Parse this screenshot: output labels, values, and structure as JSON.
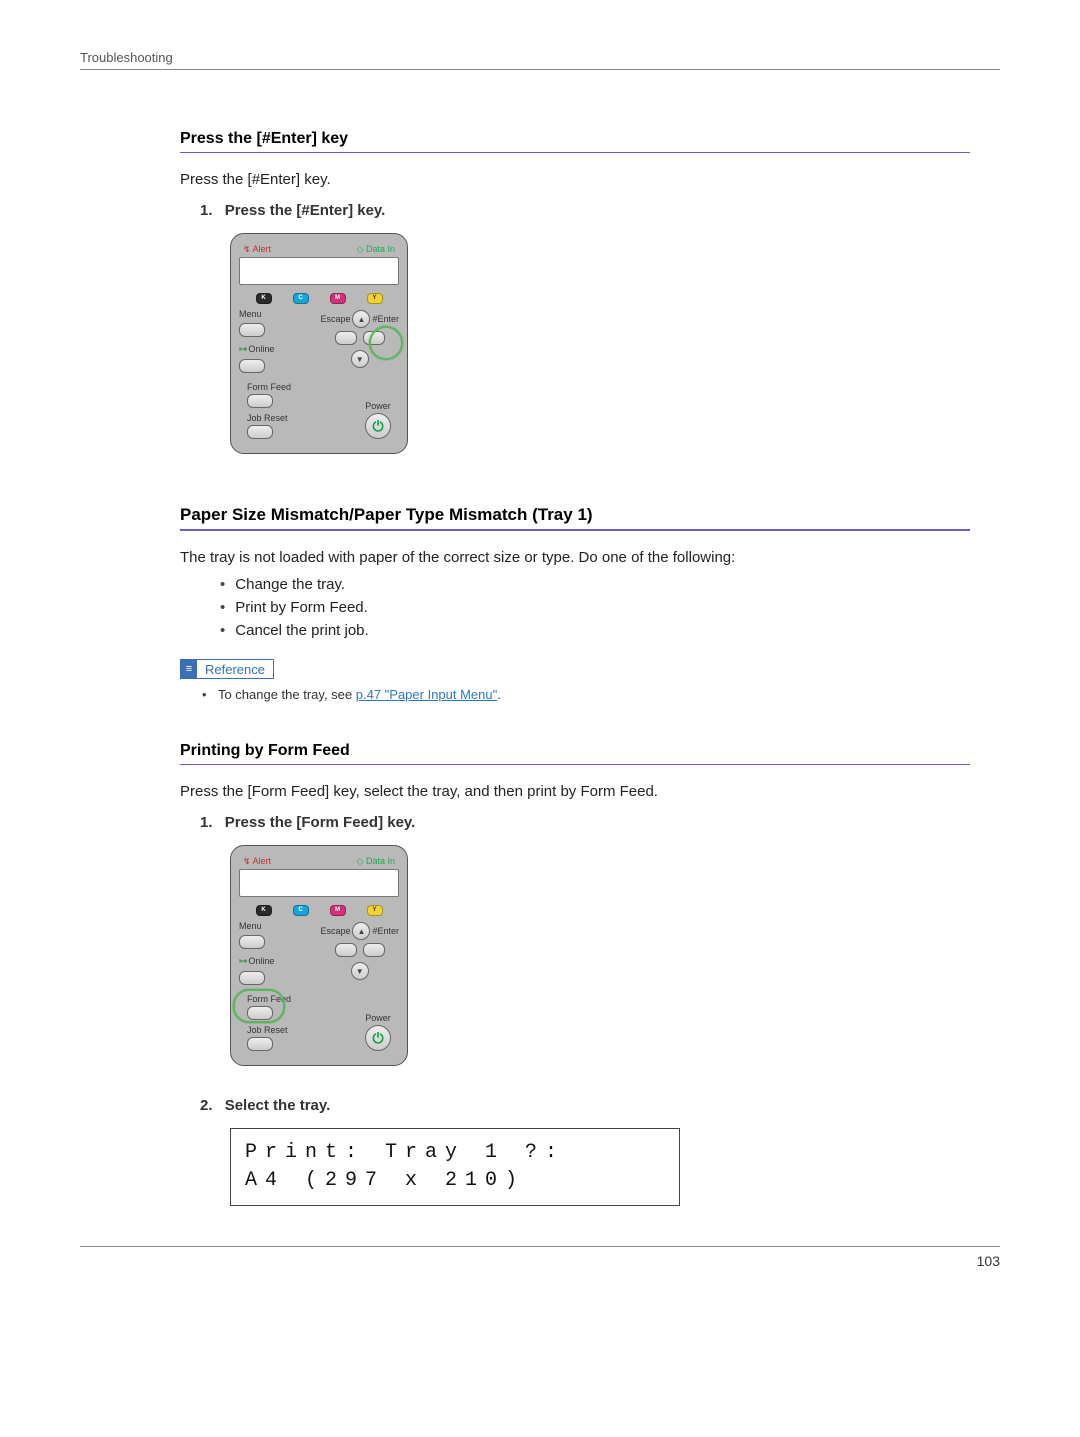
{
  "breadcrumb": "Troubleshooting",
  "page_number": "103",
  "section1": {
    "heading": "Press the [#Enter] key",
    "intro": "Press the [#Enter] key.",
    "step1_num": "1.",
    "step1_text": "Press the [#Enter] key."
  },
  "panel": {
    "alert": "Alert",
    "data_in": "Data In",
    "toner_k": "K",
    "toner_c": "C",
    "toner_m": "M",
    "toner_y": "Y",
    "menu": "Menu",
    "escape": "Escape",
    "enter": "#Enter",
    "online": "Online",
    "form_feed": "Form Feed",
    "job_reset": "Job Reset",
    "power": "Power",
    "up": "▲",
    "down": "▼",
    "power_symbol": "⏻"
  },
  "section2": {
    "heading": "Paper Size Mismatch/Paper Type Mismatch (Tray 1)",
    "intro": "The tray is not loaded with paper of the correct size or type. Do one of the following:",
    "bullets": [
      "Change the tray.",
      "Print by Form Feed.",
      "Cancel the print job."
    ],
    "reference_label": "Reference",
    "reference_text_pre": "To change the tray, see ",
    "reference_link": "p.47 \"Paper Input Menu\"",
    "reference_text_post": "."
  },
  "section3": {
    "heading": "Printing by Form Feed",
    "intro": "Press the [Form Feed] key, select the tray, and then print by Form Feed.",
    "step1_num": "1.",
    "step1_text": "Press the [Form Feed] key.",
    "step2_num": "2.",
    "step2_text": "Select the tray.",
    "lcd_line1": "Print: Tray 1 ?:",
    "lcd_line2": "A4 (297 x 210)"
  }
}
